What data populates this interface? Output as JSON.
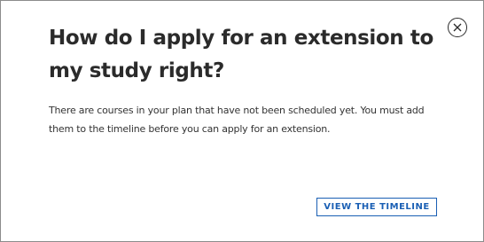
{
  "dialog": {
    "title": "How do I apply for an extension to my study right?",
    "body": "There are courses in your plan that have not been scheduled yet. You must add them to the timeline before you can apply for an extension.",
    "primary_button_label": "VIEW THE TIMELINE",
    "close_icon": "close-icon"
  },
  "colors": {
    "accent": "#1a5fb4",
    "title_text": "#2b2b2b",
    "body_text": "#333333"
  }
}
